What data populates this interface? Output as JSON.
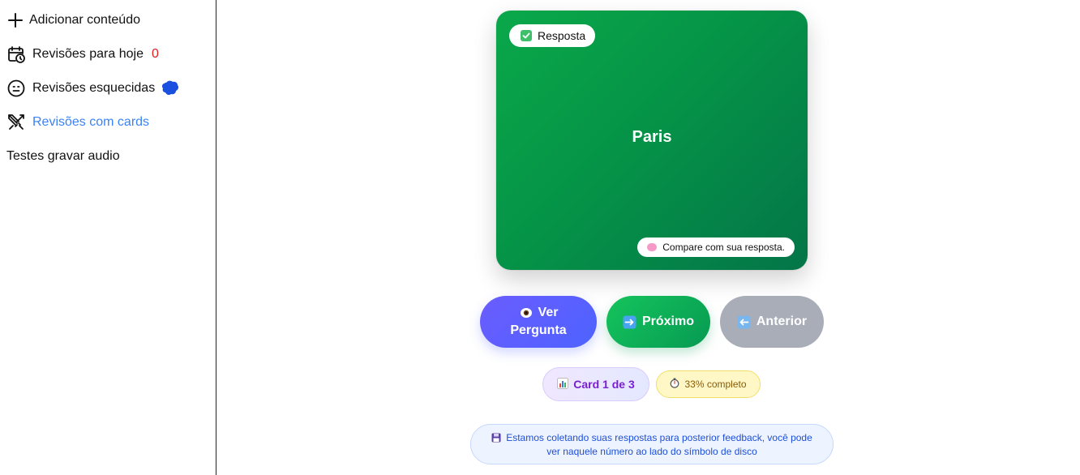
{
  "sidebar": {
    "items": [
      {
        "label": "Adicionar conteúdo",
        "icon": "plus-icon"
      },
      {
        "label": "Revisões para hoje",
        "icon": "calendar-clock-icon",
        "count": "0"
      },
      {
        "label": "Revisões esquecidas",
        "icon": "neutral-face-icon",
        "extra_icon": "blue-blob-icon"
      },
      {
        "label": "Revisões com cards",
        "icon": "crossed-swords-icon",
        "active": true
      },
      {
        "label": "Testes gravar audio"
      }
    ]
  },
  "card": {
    "chip_label": "Resposta",
    "answer": "Paris",
    "hint": "Compare com sua resposta."
  },
  "buttons": {
    "ver_pergunta": "Ver Pergunta",
    "proximo": "Próximo",
    "anterior": "Anterior"
  },
  "progress": {
    "card_label": "Card 1 de 3",
    "complete_label": "33% completo",
    "current": 1,
    "total": 3,
    "percent": 33
  },
  "info": {
    "text": "Estamos coletando suas respostas para posterior feedback, você pode ver naquele número ao lado do símbolo de disco"
  },
  "colors": {
    "card_green": "#059447",
    "accent_blue": "#3b82f6",
    "count_red": "#e11d1d",
    "ver_button": "#5b60ff",
    "prox_button": "#0fb458",
    "ant_button": "#a9adb8"
  }
}
